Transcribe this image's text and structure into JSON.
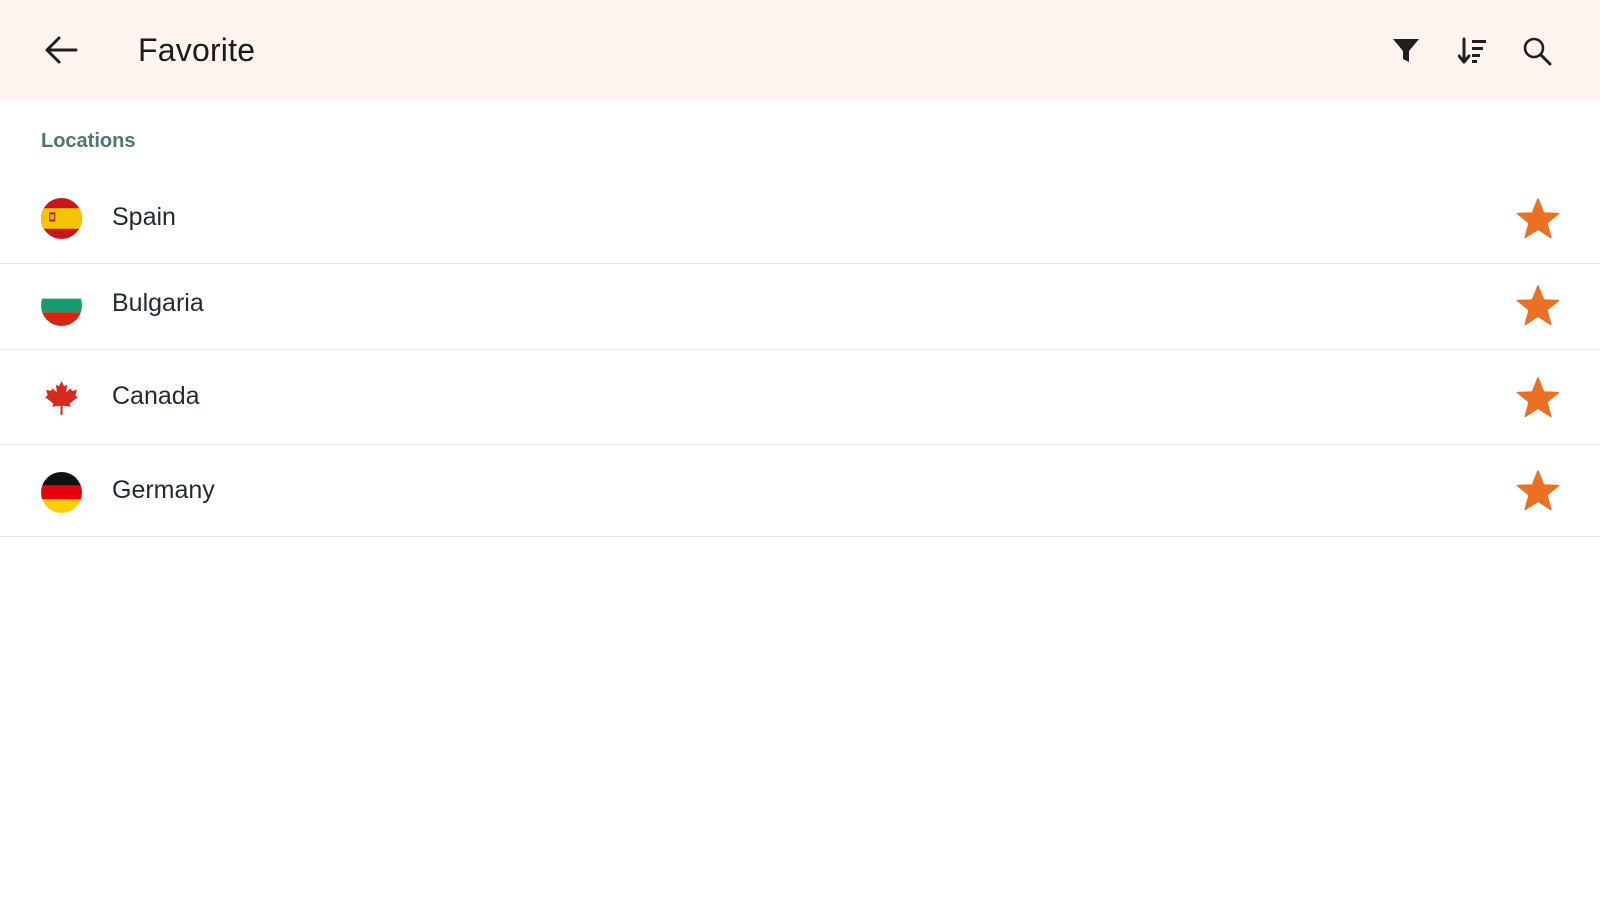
{
  "header": {
    "title": "Favorite",
    "back_icon": "arrow-left-icon",
    "actions": [
      {
        "icon": "filter-icon"
      },
      {
        "icon": "sort-icon"
      },
      {
        "icon": "search-icon"
      }
    ]
  },
  "section": {
    "label": "Locations"
  },
  "locations": [
    {
      "name": "Spain",
      "flag": "spain-flag-icon",
      "favorite": true
    },
    {
      "name": "Bulgaria",
      "flag": "bulgaria-flag-icon",
      "favorite": true
    },
    {
      "name": "Canada",
      "flag": "canada-flag-icon",
      "favorite": true
    },
    {
      "name": "Germany",
      "flag": "germany-flag-icon",
      "favorite": true
    }
  ],
  "colors": {
    "topbar_bg": "#fdf4ef",
    "section_label": "#4f7672",
    "star": "#ea7124",
    "divider": "#e6e6e6"
  }
}
